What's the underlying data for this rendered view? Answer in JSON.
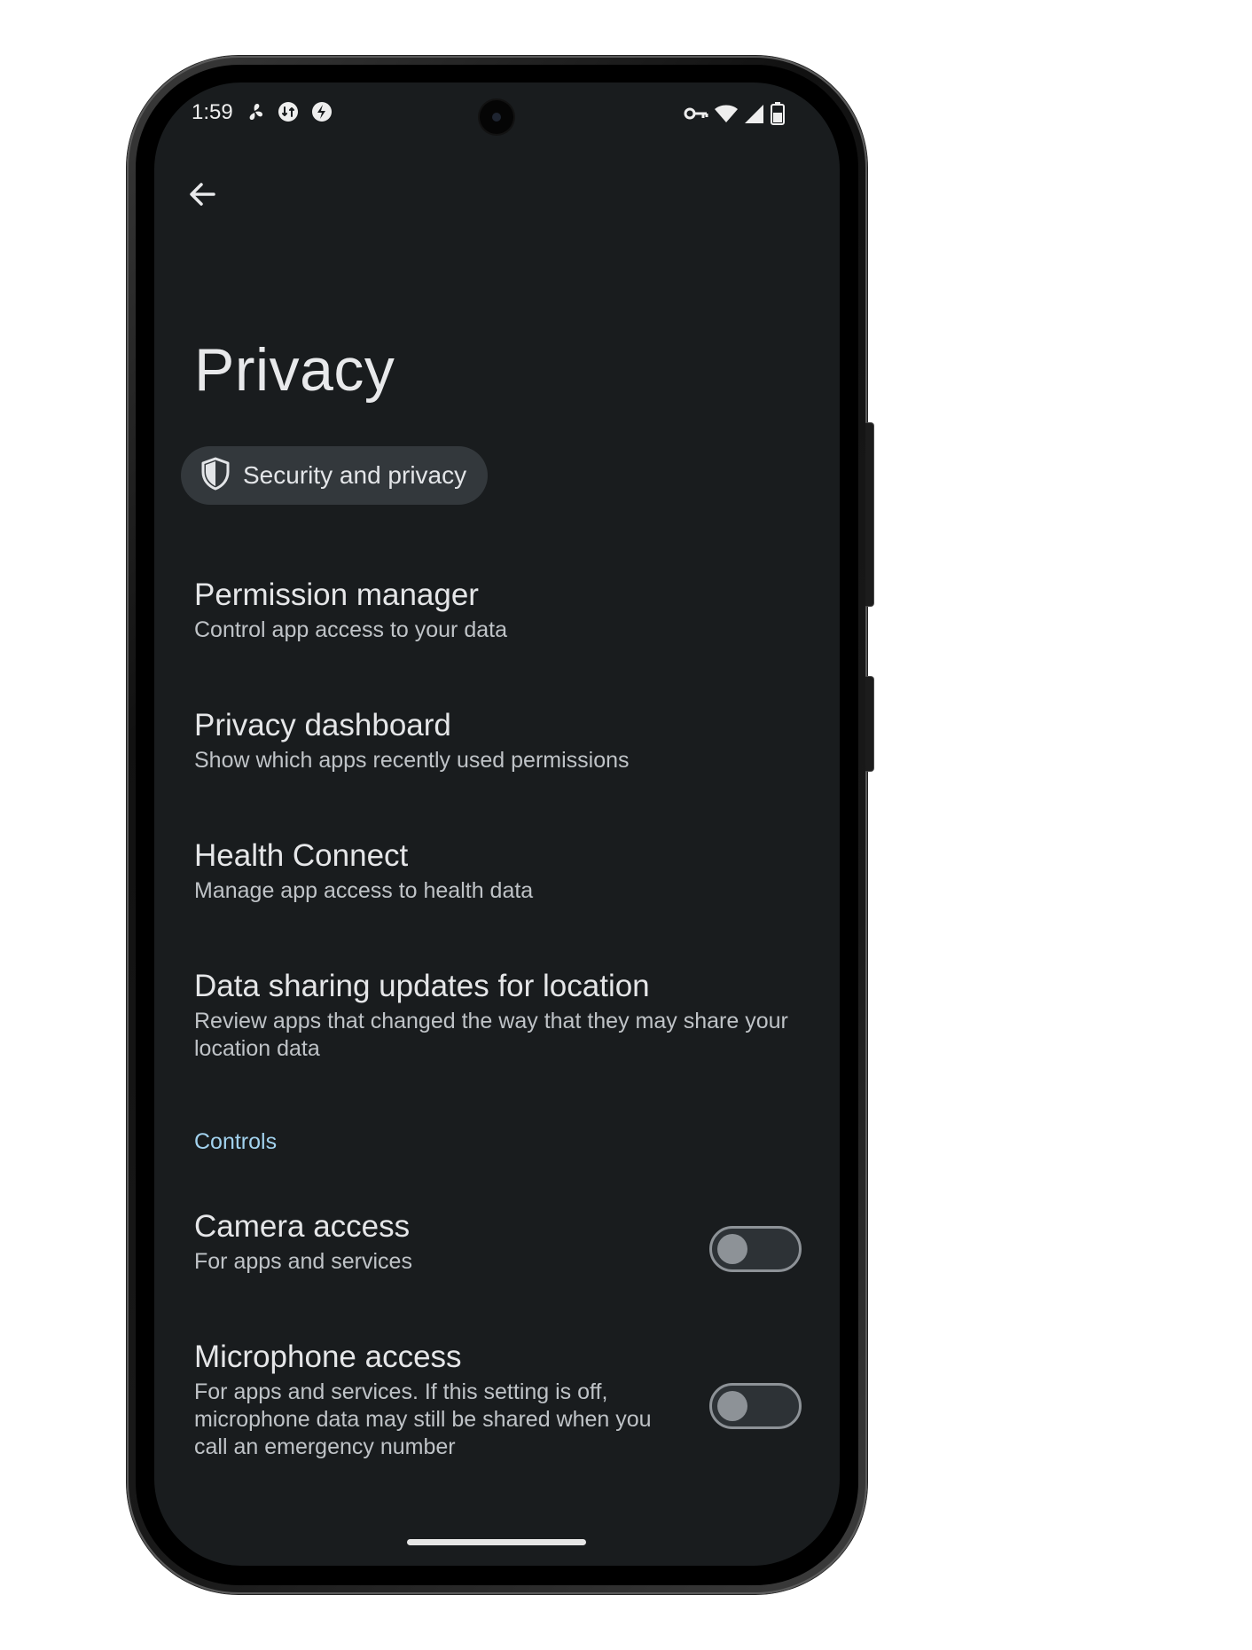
{
  "status_bar": {
    "time": "1:59",
    "left_icons": [
      "fan-icon",
      "data-saver-icon",
      "flash-icon"
    ],
    "right_icons": [
      "vpn-key-icon",
      "wifi-icon",
      "cell-signal-icon",
      "battery-icon"
    ]
  },
  "toolbar": {
    "back_icon": "arrow-back-icon"
  },
  "page": {
    "title": "Privacy"
  },
  "breadcrumb_chip": {
    "icon": "shield-icon",
    "label": "Security and privacy"
  },
  "preferences": [
    {
      "title": "Permission manager",
      "summary": "Control app access to your data"
    },
    {
      "title": "Privacy dashboard",
      "summary": "Show which apps recently used permissions"
    },
    {
      "title": "Health Connect",
      "summary": "Manage app access to health data"
    },
    {
      "title": "Data sharing updates for location",
      "summary": "Review apps that changed the way that they may share your location data"
    }
  ],
  "controls": {
    "header": "Controls",
    "items": [
      {
        "title": "Camera access",
        "summary": "For apps and services",
        "enabled": false
      },
      {
        "title": "Microphone access",
        "summary": "For apps and services. If this setting is off, microphone data may still be shared when you call an emergency number",
        "enabled": false
      }
    ]
  },
  "colors": {
    "screen_background": "#191c1e",
    "chip_background": "#33383c",
    "section_header": "#a2d2ee",
    "toggle_off": "#8d9297"
  }
}
